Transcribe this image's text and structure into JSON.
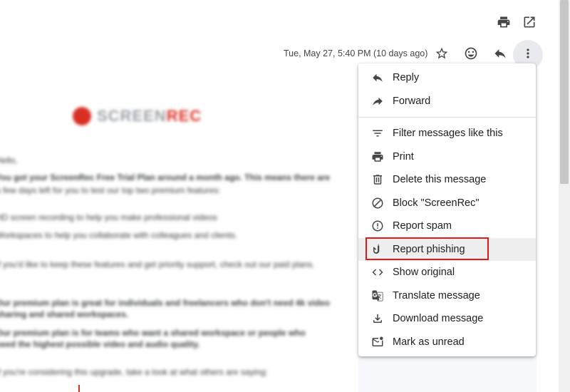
{
  "toolbar": {
    "print_icon": "print-icon",
    "open_new_window_icon": "open-in-new-icon"
  },
  "message_header": {
    "date": "Tue, May 27, 5:40 PM (10 days ago)",
    "icons": [
      "star-icon",
      "emoji-icon",
      "reply-icon",
      "more-vert-icon"
    ]
  },
  "email": {
    "brand_a": "SCREEN",
    "brand_b": "REC",
    "lines": [
      "Hello,",
      "You got your ScreenRec Free Trial Plan around a month ago. This means there are",
      "a few days left for you to test our top two premium features:",
      "HD screen recording to help you make professional videos",
      "Workspaces to help you collaborate with colleagues and clients.",
      "If you'd like to keep these features and get priority support, check out our paid plans.",
      "Our premium plan is great for individuals and freelancers who don't need 4k video",
      "sharing and shared workspaces.",
      "Our premium plan is for teams who want a shared workspace or people who",
      "need the highest possible video and audio quality.",
      "If you're considering this upgrade, take a look at what others are saying:"
    ]
  },
  "menu": {
    "items": [
      {
        "label": "Reply",
        "icon": "reply-icon"
      },
      {
        "label": "Forward",
        "icon": "forward-icon"
      },
      {
        "label": "Filter messages like this",
        "icon": "filter-icon"
      },
      {
        "label": "Print",
        "icon": "print-icon"
      },
      {
        "label": "Delete this message",
        "icon": "trash-icon"
      },
      {
        "label": "Block \"ScreenRec\"",
        "icon": "block-icon"
      },
      {
        "label": "Report spam",
        "icon": "report-icon"
      },
      {
        "label": "Report phishing",
        "icon": "phishing-hook-icon"
      },
      {
        "label": "Show original",
        "icon": "code-icon"
      },
      {
        "label": "Translate message",
        "icon": "translate-icon"
      },
      {
        "label": "Download message",
        "icon": "download-icon"
      },
      {
        "label": "Mark as unread",
        "icon": "mark-unread-icon"
      }
    ],
    "highlighted": "Report phishing"
  },
  "colors": {
    "highlight_border": "#e0191b",
    "hover_bg": "#eeeeee",
    "icon": "#444746"
  }
}
